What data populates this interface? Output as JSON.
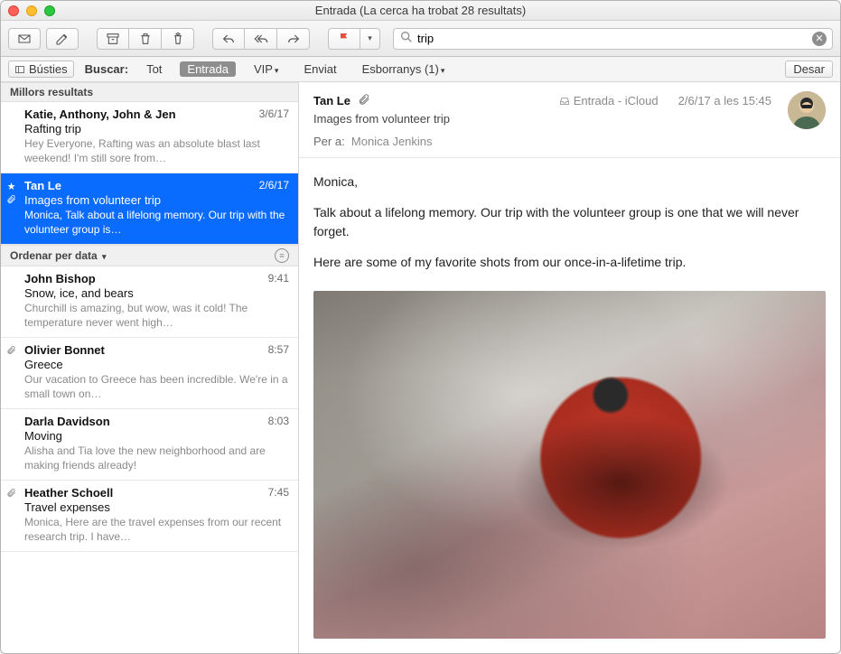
{
  "window": {
    "title": "Entrada (La cerca ha trobat 28 resultats)"
  },
  "search": {
    "value": "trip",
    "placeholder": ""
  },
  "favorites": {
    "mailboxes": "Bústies",
    "search_label": "Buscar:",
    "scopes": {
      "all": "Tot",
      "inbox": "Entrada",
      "vip": "VIP",
      "sent": "Enviat",
      "drafts": "Esborranys (1)"
    },
    "save": "Desar"
  },
  "list": {
    "top_hits": "Millors resultats",
    "sort_label": "Ordenar per data",
    "messages": [
      {
        "from": "Katie, Anthony, John & Jen",
        "date": "3/6/17",
        "subject": "Rafting trip",
        "preview": "Hey Everyone, Rafting was an absolute blast last weekend! I'm still sore from…",
        "star": false,
        "clip": false,
        "selected": false,
        "section": "top"
      },
      {
        "from": "Tan Le",
        "date": "2/6/17",
        "subject": "Images from volunteer trip",
        "preview": "Monica, Talk about a lifelong memory. Our trip with the volunteer group is…",
        "star": true,
        "clip": true,
        "selected": true,
        "section": "top"
      },
      {
        "from": "John Bishop",
        "date": "9:41",
        "subject": "Snow, ice, and bears",
        "preview": "Churchill is amazing, but wow, was it cold! The temperature never went high…",
        "star": false,
        "clip": false,
        "selected": false,
        "section": "date"
      },
      {
        "from": "Olivier Bonnet",
        "date": "8:57",
        "subject": "Greece",
        "preview": "Our vacation to Greece has been incredible. We're in a small town on…",
        "star": false,
        "clip": true,
        "selected": false,
        "section": "date"
      },
      {
        "from": "Darla Davidson",
        "date": "8:03",
        "subject": "Moving",
        "preview": "Alisha and Tia love the new neighborhood and are making friends already!",
        "star": false,
        "clip": false,
        "selected": false,
        "section": "date"
      },
      {
        "from": "Heather Schoell",
        "date": "7:45",
        "subject": "Travel expenses",
        "preview": "Monica, Here are the travel expenses from our recent research trip. I have…",
        "star": false,
        "clip": true,
        "selected": false,
        "section": "date"
      }
    ]
  },
  "reader": {
    "sender": "Tan Le",
    "mailbox": "Entrada - iCloud",
    "timestamp": "2/6/17 a les 15:45",
    "subject": "Images from volunteer trip",
    "to_label": "Per a:",
    "to_name": "Monica Jenkins",
    "body_greeting": "Monica,",
    "body_p1": "Talk about a lifelong memory. Our trip with the volunteer group is one that we will never forget.",
    "body_p2": "Here are some of my favorite shots from our once-in-a-lifetime trip."
  }
}
